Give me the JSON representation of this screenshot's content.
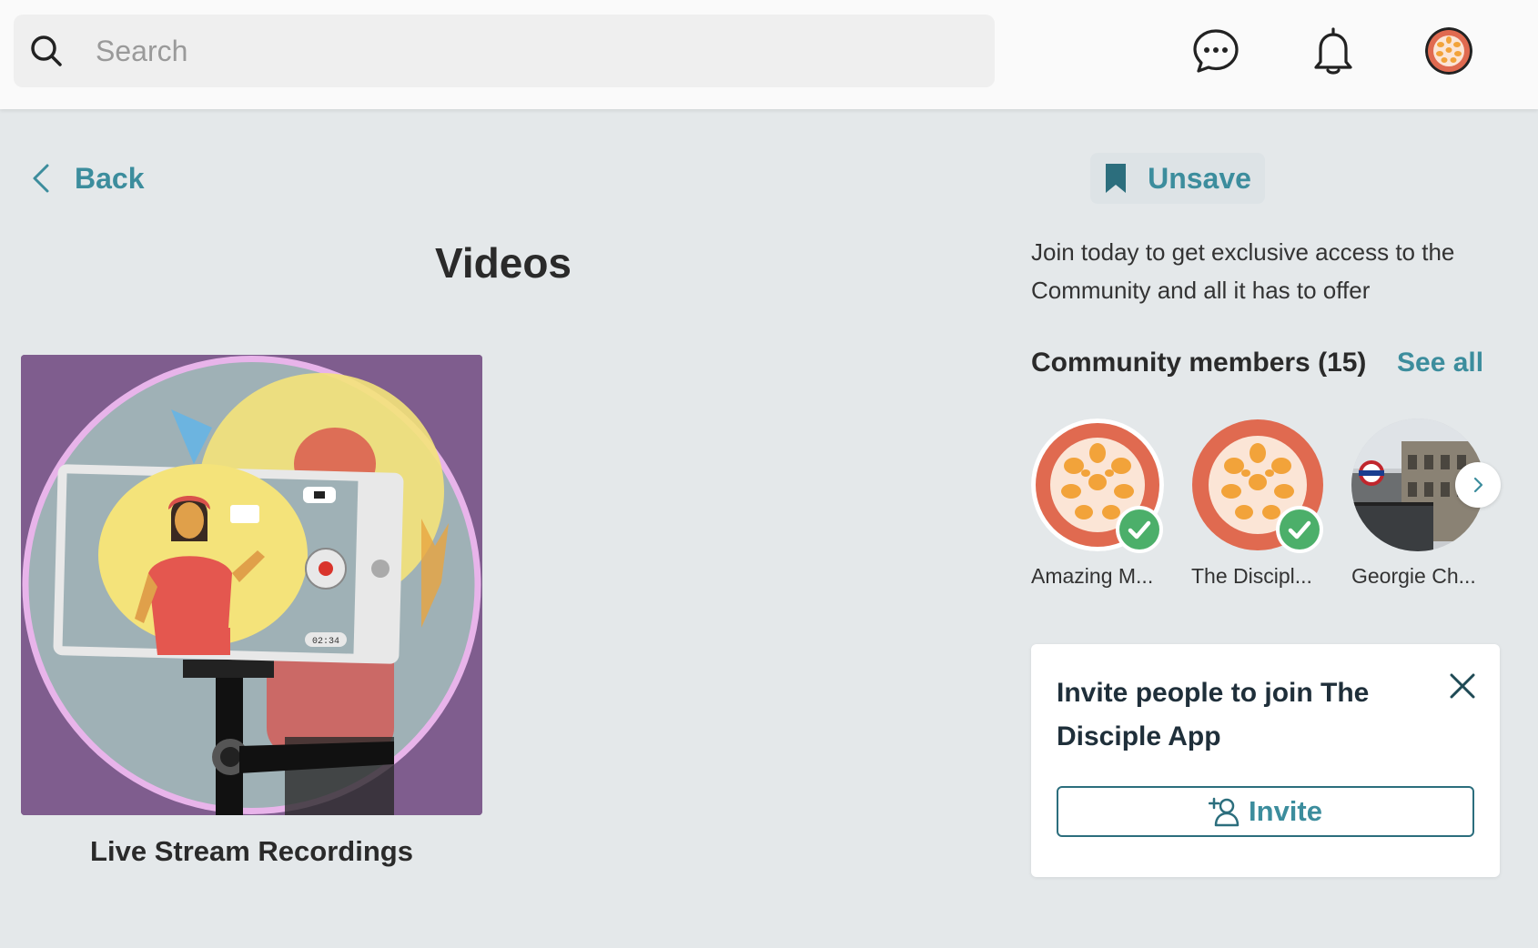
{
  "header": {
    "search_placeholder": "Search",
    "icons": [
      "search-icon",
      "chat-icon",
      "bell-icon",
      "profile-avatar"
    ]
  },
  "nav": {
    "back_label": "Back"
  },
  "main": {
    "page_title": "Videos",
    "cards": [
      {
        "title": "Live Stream Recordings",
        "overlay_timestamp": "02:34"
      }
    ]
  },
  "sidebar": {
    "unsave_label": "Unsave",
    "join_text": "Join today to get exclusive access to the Community and all it has to offer",
    "members_title": "Community members (15)",
    "see_all_label": "See all",
    "members": [
      {
        "name": "Amazing M...",
        "verified": true
      },
      {
        "name": "The Discipl...",
        "verified": true
      },
      {
        "name": "Georgie Ch...",
        "verified": false
      }
    ],
    "invite": {
      "title": "Invite people to join The Disciple App",
      "button_label": "Invite"
    }
  },
  "colors": {
    "accent": "#3c8d9d",
    "background": "#e4e8ea",
    "verified_green": "#4caf6a",
    "avatar_orange": "#e06a50",
    "avatar_yellow": "#f2a33a",
    "card_purple": "#7f5d8e"
  }
}
